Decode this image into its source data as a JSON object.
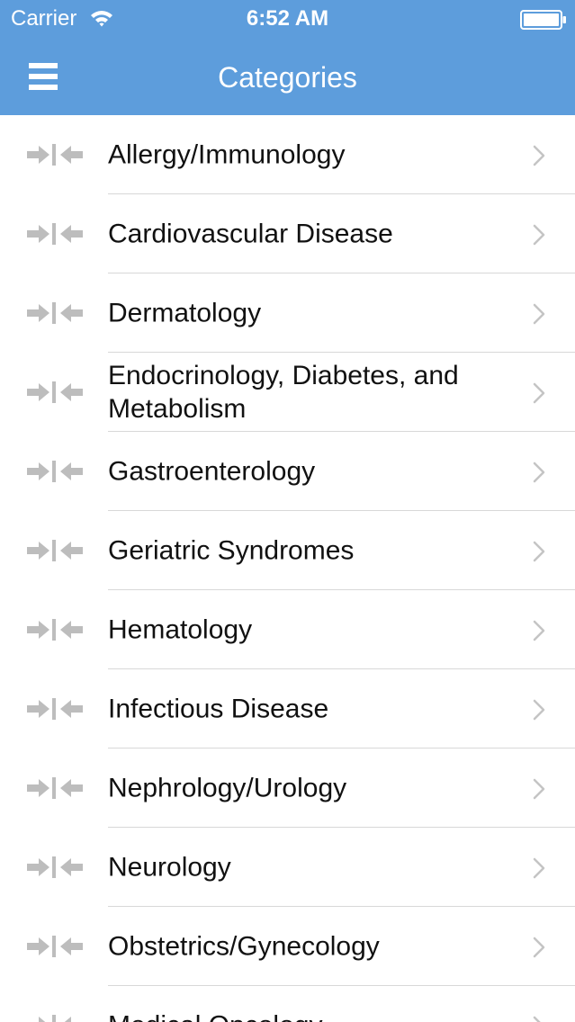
{
  "status_bar": {
    "carrier": "Carrier",
    "time": "6:52 AM"
  },
  "nav": {
    "title": "Categories",
    "menu_icon": "hamburger-menu-icon"
  },
  "colors": {
    "header_bg": "#5d9ddc",
    "icon_gray": "#bdbdbd",
    "chevron_gray": "#c4c4c4",
    "separator": "#d8d8d8"
  },
  "categories": [
    {
      "label": "Allergy/Immunology"
    },
    {
      "label": "Cardiovascular Disease"
    },
    {
      "label": "Dermatology"
    },
    {
      "label": "Endocrinology, Diabetes, and Metabolism"
    },
    {
      "label": "Gastroenterology"
    },
    {
      "label": "Geriatric Syndromes"
    },
    {
      "label": "Hematology"
    },
    {
      "label": "Infectious Disease"
    },
    {
      "label": "Nephrology/Urology"
    },
    {
      "label": "Neurology"
    },
    {
      "label": "Obstetrics/Gynecology"
    },
    {
      "label": "Medical Oncology"
    }
  ]
}
